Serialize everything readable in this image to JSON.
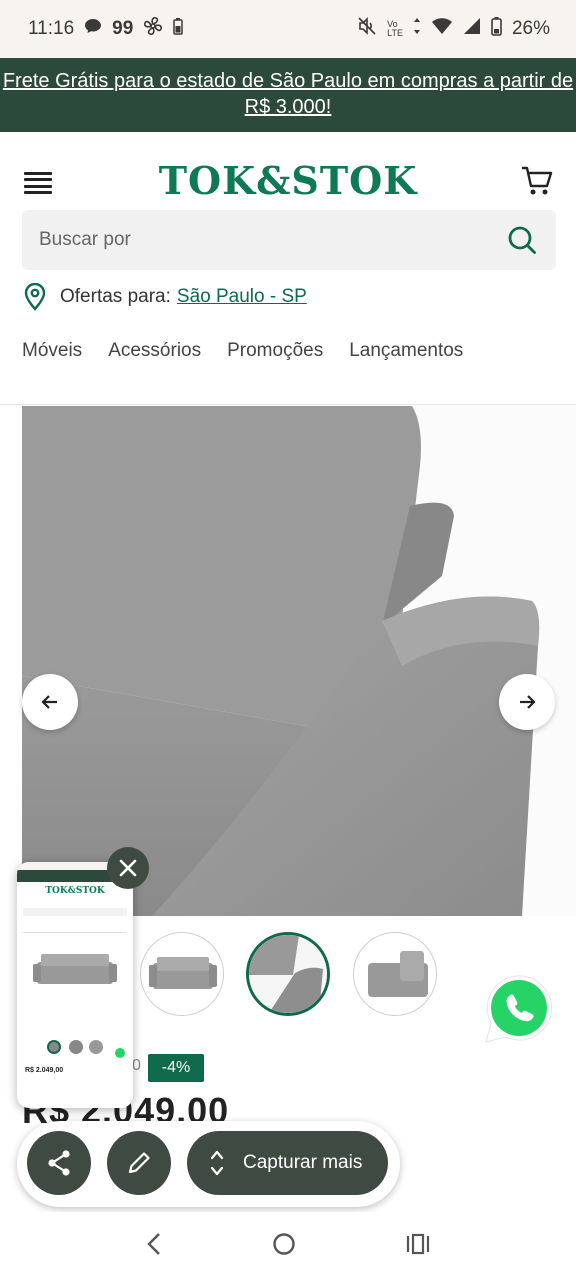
{
  "status_bar": {
    "time": "11:16",
    "notif_count": "99",
    "battery": "26%"
  },
  "banner": {
    "text": "Frete Grátis para o estado de São Paulo em compras a partir de R$ 3.000!"
  },
  "header": {
    "logo": "TOK&STOK"
  },
  "search": {
    "placeholder": "Buscar por"
  },
  "location": {
    "label": "Ofertas para:",
    "city": "São Paulo - SP"
  },
  "nav": {
    "items": [
      "Móveis",
      "Acessórios",
      "Promoções",
      "Lançamentos"
    ]
  },
  "product": {
    "discount": "-4%",
    "price": "R$ 2.049,00"
  },
  "preview": {
    "logo": "TOK&STOK",
    "price": "R$ 2.049,00"
  },
  "toolbar": {
    "capture_label": "Capturar mais"
  },
  "colors": {
    "brand_green": "#0e7a55",
    "banner_bg": "#2b4a3b",
    "toolbar_bg": "#3f4a43",
    "whatsapp": "#25d366"
  }
}
